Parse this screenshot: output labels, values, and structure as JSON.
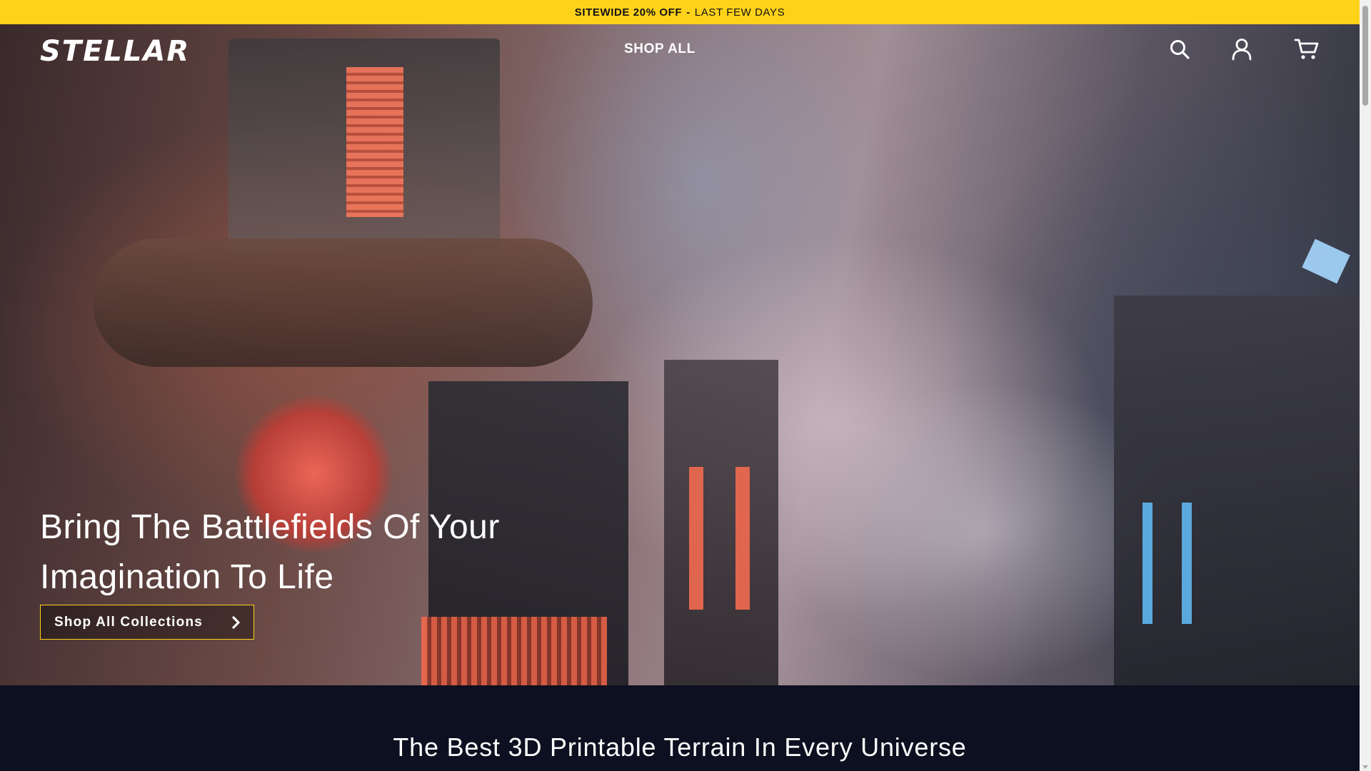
{
  "announcement": {
    "highlight": "SITEWIDE 20% OFF",
    "separator": "-",
    "text": "LAST FEW DAYS"
  },
  "header": {
    "logo_text": "STELLAR",
    "nav": {
      "shop_all": "SHOP ALL"
    },
    "icons": [
      "search-icon",
      "account-icon",
      "cart-icon"
    ]
  },
  "hero": {
    "title": "Bring The Battlefields Of Your Imagination To Life",
    "cta_label": "Shop All Collections"
  },
  "section": {
    "title": "The Best 3D Printable Terrain In Every Universe"
  },
  "colors": {
    "accent": "#ffd21a",
    "background_dark": "#0d1020"
  }
}
